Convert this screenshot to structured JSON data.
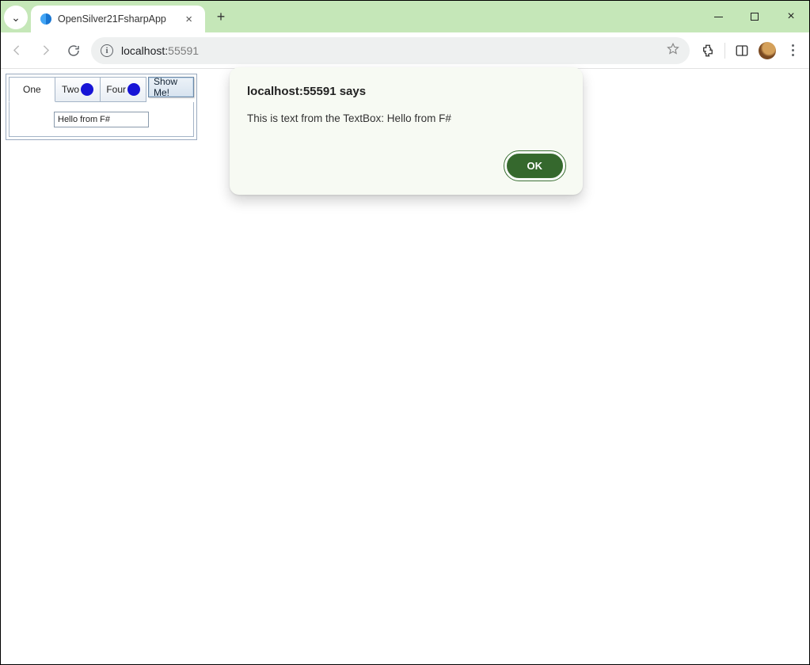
{
  "browser": {
    "tab_title": "OpenSilver21FsharpApp",
    "url_host": "localhost:",
    "url_port": "55591"
  },
  "app_panel": {
    "tabs": [
      "One",
      "Two",
      "",
      "Four"
    ],
    "active_tab": 0,
    "textbox_value": "Hello from F#",
    "show_button": "Show Me!"
  },
  "dialog": {
    "title": "localhost:55591 says",
    "message": "This is text from the TextBox: Hello from F#",
    "ok": "OK"
  }
}
